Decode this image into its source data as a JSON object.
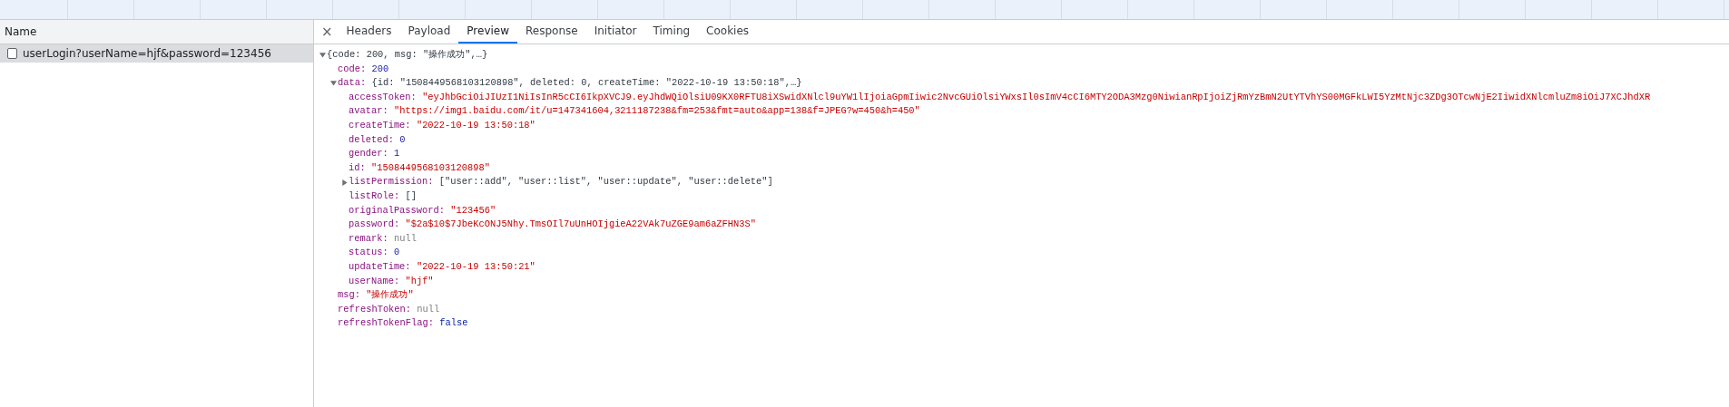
{
  "requests": {
    "column_header": "Name",
    "items": [
      {
        "name": "userLogin?userName=hjf&password=123456",
        "selected": true
      }
    ]
  },
  "detail_tabs": {
    "close": "×",
    "tabs": [
      {
        "label": "Headers",
        "selected": false
      },
      {
        "label": "Payload",
        "selected": false
      },
      {
        "label": "Preview",
        "selected": true
      },
      {
        "label": "Response",
        "selected": false
      },
      {
        "label": "Initiator",
        "selected": false
      },
      {
        "label": "Timing",
        "selected": false
      },
      {
        "label": "Cookies",
        "selected": false
      }
    ]
  },
  "preview": {
    "summary": "{code: 200, msg: \"操作成功\",…}",
    "expanded": true,
    "children": [
      {
        "key": "code:",
        "kind": "number",
        "value": "200"
      },
      {
        "key": "data:",
        "kind": "object",
        "expanded": true,
        "value": "{id: \"1508449568103120898\", deleted: 0, createTime: \"2022-10-19 13:50:18\",…}",
        "children": [
          {
            "key": "accessToken:",
            "kind": "string",
            "value": "\"eyJhbGciOiJIUzI1NiIsInR5cCI6IkpXVCJ9.eyJhdWQiOlsiU09KX0RFTU8iXSwidXNlcl9uYW1lIjoiaGpmIiwic2NvcGUiOlsiYWxsIl0sImV4cCI6MTY2ODA3Mzg0NiwianRpIjoiZjRmYzBmN2UtYTVhYS00MGFkLWI5YzMtNjc3ZDg3OTcwNjE2IiwidXNlcmluZm8iOiJ7XCJhdXR"
          },
          {
            "key": "avatar:",
            "kind": "string",
            "value": "\"https://img1.baidu.com/it/u=147341604,3211187238&fm=253&fmt=auto&app=138&f=JPEG?w=450&h=450\""
          },
          {
            "key": "createTime:",
            "kind": "string",
            "value": "\"2022-10-19 13:50:18\""
          },
          {
            "key": "deleted:",
            "kind": "number",
            "value": "0"
          },
          {
            "key": "gender:",
            "kind": "number",
            "value": "1"
          },
          {
            "key": "id:",
            "kind": "string",
            "value": "\"1508449568103120898\""
          },
          {
            "key": "listPermission:",
            "kind": "array",
            "expanded": false,
            "value": "[\"user::add\", \"user::list\", \"user::update\", \"user::delete\"]"
          },
          {
            "key": "listRole:",
            "kind": "empty",
            "value": "[]"
          },
          {
            "key": "originalPassword:",
            "kind": "string",
            "value": "\"123456\""
          },
          {
            "key": "password:",
            "kind": "string",
            "value": "\"$2a$10$7JbeKcONJ5Nhy.TmsOIl7uUnHOIjgieA22VAk7uZGE9am6aZFHN3S\""
          },
          {
            "key": "remark:",
            "kind": "null",
            "value": "null"
          },
          {
            "key": "status:",
            "kind": "number",
            "value": "0"
          },
          {
            "key": "updateTime:",
            "kind": "string",
            "value": "\"2022-10-19 13:50:21\""
          },
          {
            "key": "userName:",
            "kind": "string",
            "value": "\"hjf\""
          }
        ]
      },
      {
        "key": "msg:",
        "kind": "string",
        "value": "\"操作成功\""
      },
      {
        "key": "refreshToken:",
        "kind": "null",
        "value": "null"
      },
      {
        "key": "refreshTokenFlag:",
        "kind": "boolean",
        "value": "false"
      }
    ]
  }
}
